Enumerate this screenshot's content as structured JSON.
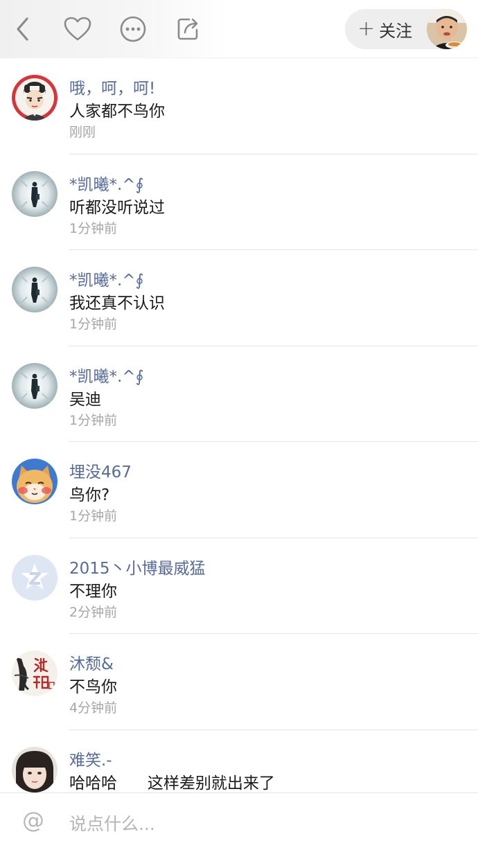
{
  "topbar": {
    "back_icon": "back-chevron-icon",
    "like_icon": "heart-icon",
    "more_icon": "more-dots-icon",
    "share_icon": "share-icon",
    "follow_label": "关注",
    "follow_plus": "+"
  },
  "comments": [
    {
      "name": "哦，呵，呵!",
      "text": "人家都不鸟你",
      "time": "刚刚",
      "avatar": "cartoon-boy-avatar"
    },
    {
      "name": "*凯曦*.^∮",
      "text": "听都没听说过",
      "time": "1分钟前",
      "avatar": "tunnel-figure-avatar"
    },
    {
      "name": "*凯曦*.^∮",
      "text": "我还真不认识",
      "time": "1分钟前",
      "avatar": "tunnel-figure-avatar"
    },
    {
      "name": "*凯曦*.^∮",
      "text": "吴迪",
      "time": "1分钟前",
      "avatar": "tunnel-figure-avatar"
    },
    {
      "name": "埋没467",
      "text": "鸟你?",
      "time": "1分钟前",
      "avatar": "cat-avatar"
    },
    {
      "name": "2015丶小博最威猛",
      "text": "不理你",
      "time": "2分钟前",
      "avatar": "default-qq-avatar"
    },
    {
      "name": "沐颓&",
      "text": "不鸟你",
      "time": "4分钟前",
      "avatar": "calligraphy-avatar"
    },
    {
      "name": "难笑.-",
      "text": "哈哈哈      这样差别就出来了",
      "time": "",
      "avatar": "girl-avatar"
    }
  ],
  "input": {
    "at_symbol": "@",
    "placeholder": "说点什么..."
  },
  "colors": {
    "name": "#576b95",
    "time": "#a6a6a6",
    "divider": "#e5e5e5"
  }
}
